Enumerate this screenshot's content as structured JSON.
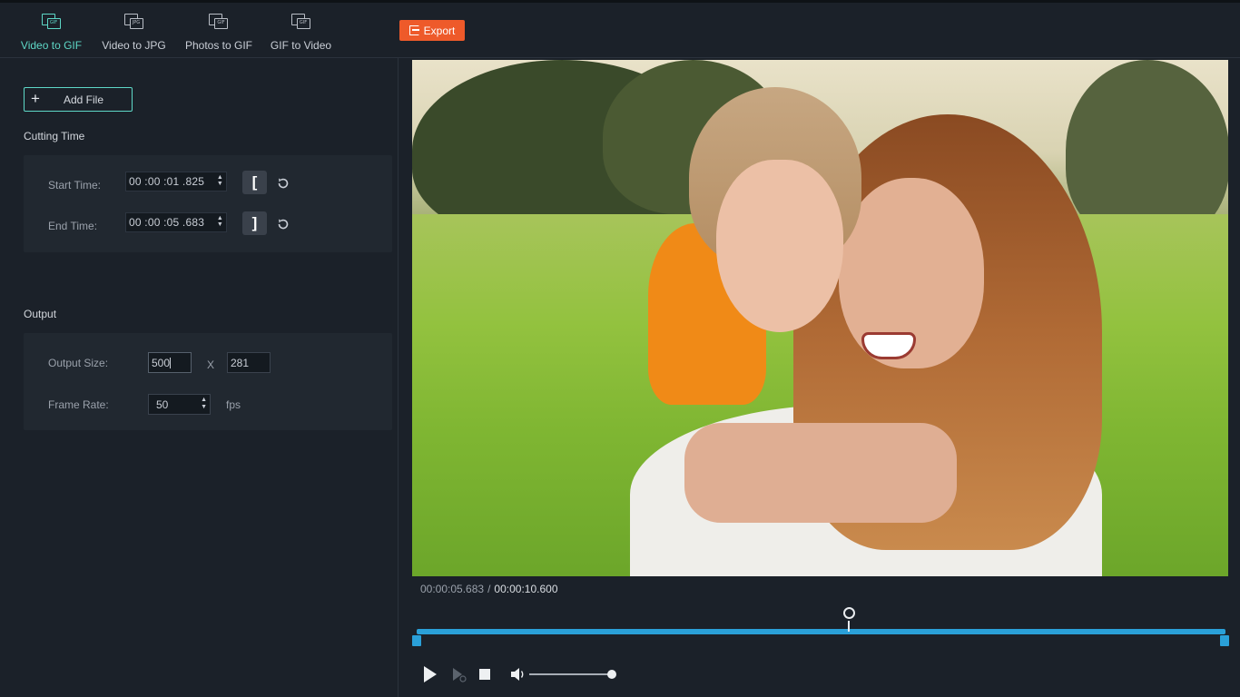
{
  "tabs": [
    {
      "label": "Video to GIF",
      "icon": "video-to-gif-icon",
      "badge": "GIF",
      "active": true
    },
    {
      "label": "Video to JPG",
      "icon": "video-to-jpg-icon",
      "badge": "JPG",
      "active": false
    },
    {
      "label": "Photos to GIF",
      "icon": "photos-to-gif-icon",
      "badge": "GIF",
      "active": false
    },
    {
      "label": "GIF to Video",
      "icon": "gif-to-video-icon",
      "badge": "GIF",
      "active": false
    }
  ],
  "export": {
    "label": "Export",
    "color": "#ee5a2a"
  },
  "accent": "#5ed8c7",
  "add_file": {
    "label": "Add File"
  },
  "cutting": {
    "title": "Cutting Time",
    "start_label": "Start Time:",
    "start_value": "00 :00 :01 .825",
    "end_label": "End Time:",
    "end_value": "00 :00 :05 .683",
    "start_bracket": "[",
    "end_bracket": "]"
  },
  "output": {
    "title": "Output",
    "size_label": "Output Size:",
    "width": "500",
    "x_label": "X",
    "height": "281",
    "frame_rate_label": "Frame Rate:",
    "frame_rate": "50",
    "fps_label": "fps"
  },
  "player": {
    "current_time": "00:00:05.683",
    "separator": "/",
    "total_time": "00:00:10.600",
    "timeline_color": "#2aa0d8",
    "playhead_fraction": 0.536,
    "volume_fraction": 1.0
  }
}
